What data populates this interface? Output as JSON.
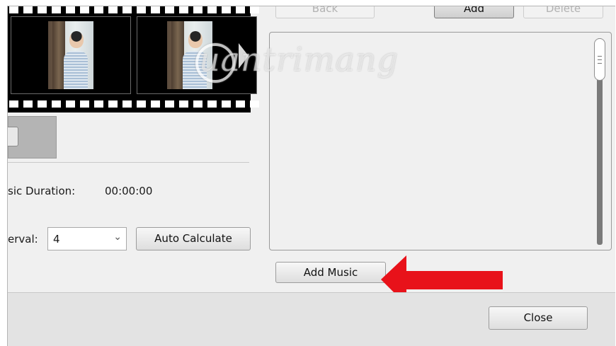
{
  "top_buttons": {
    "back_label": "Back",
    "add_label": "Add",
    "delete_label": "Delete"
  },
  "music": {
    "duration_label": "sic Duration:",
    "duration_value": "00:00:00",
    "interval_label": "erval:",
    "interval_value": "4",
    "auto_calculate_label": "Auto Calculate",
    "add_music_label": "Add Music"
  },
  "footer": {
    "close_label": "Close"
  },
  "watermark": {
    "text": "uantrimang"
  },
  "colors": {
    "arrow": "#e8121a",
    "filmstrip": "#000000"
  }
}
